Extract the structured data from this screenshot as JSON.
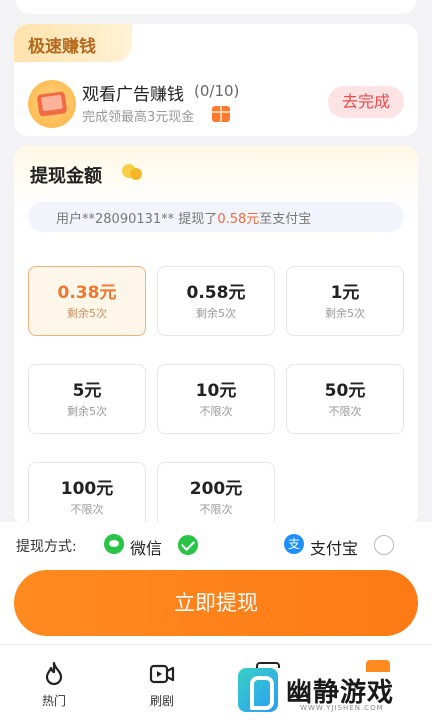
{
  "fast_earn": {
    "tag": "极速赚钱",
    "task_title": "观看广告赚钱",
    "task_progress": "(0/10)",
    "task_desc": "完成领最高3元现金",
    "go_button": "去完成"
  },
  "withdraw": {
    "title": "提现金额",
    "notice_prefix": "用户**28090131** 提现了",
    "notice_amount": "0.58元",
    "notice_suffix": "至支付宝",
    "options": [
      {
        "amount": "0.38元",
        "sub": "剩余5次",
        "selected": true
      },
      {
        "amount": "0.58元",
        "sub": "剩余5次",
        "selected": false
      },
      {
        "amount": "1元",
        "sub": "剩余5次",
        "selected": false
      },
      {
        "amount": "5元",
        "sub": "剩余5次",
        "selected": false
      },
      {
        "amount": "10元",
        "sub": "不限次",
        "selected": false
      },
      {
        "amount": "50元",
        "sub": "不限次",
        "selected": false
      },
      {
        "amount": "100元",
        "sub": "不限次",
        "selected": false
      },
      {
        "amount": "200元",
        "sub": "不限次",
        "selected": false
      }
    ]
  },
  "payment": {
    "label": "提现方式:",
    "wechat": "微信",
    "alipay": "支付宝",
    "wechat_selected": true
  },
  "withdraw_button": "立即提现",
  "nav": {
    "items": [
      {
        "label": "热门",
        "icon": "flame-icon"
      },
      {
        "label": "刷剧",
        "icon": "video-icon"
      }
    ]
  },
  "watermark": {
    "text": "幽静游戏",
    "url": "WWW.YJISHEN.COM"
  },
  "colors": {
    "accent": "#ff7a14",
    "wechat_green": "#28c445",
    "alipay_blue": "#1f8fff",
    "highlight": "#f26a3d"
  }
}
